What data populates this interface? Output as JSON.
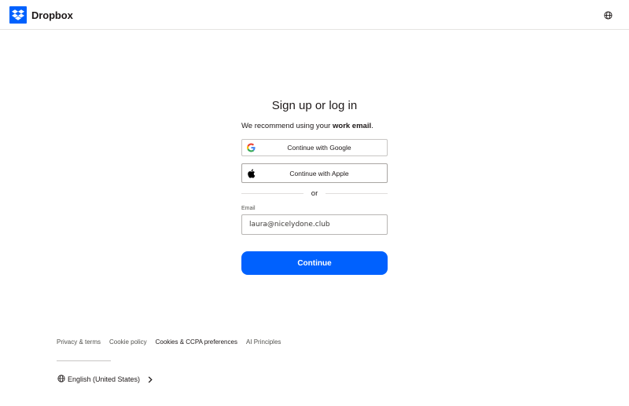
{
  "header": {
    "logo_text": "Dropbox",
    "logo_icon": "dropbox-logo-icon",
    "language_icon": "globe-icon"
  },
  "main": {
    "title": "Sign up or log in",
    "subtitle_prefix": "We recommend using your ",
    "subtitle_bold": "work email",
    "subtitle_suffix": ".",
    "google_button": "Continue with Google",
    "apple_button": "Continue with Apple",
    "divider_text": "or",
    "email_label": "Email",
    "email_value": "laura@nicelydone.club",
    "continue_button": "Continue"
  },
  "footer": {
    "links": [
      "Privacy & terms",
      "Cookie policy",
      "Cookies & CCPA preferences",
      "AI Principles"
    ],
    "language": "English (United States)"
  },
  "colors": {
    "accent": "#0061fe",
    "text": "#1e1919",
    "border": "#c8c6c4"
  }
}
